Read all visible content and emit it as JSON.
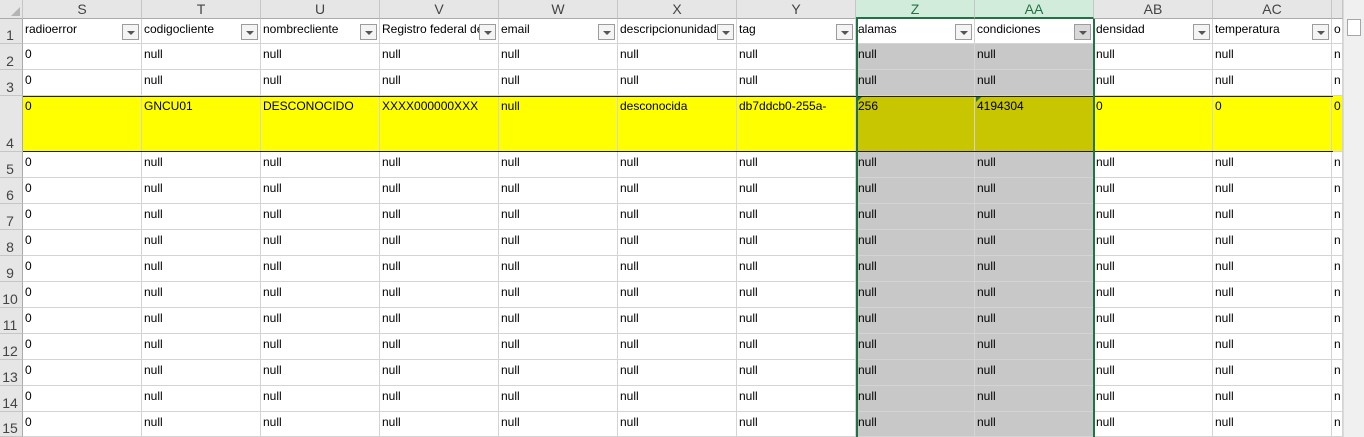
{
  "sheet": {
    "columns": [
      {
        "letter": "S",
        "header": "radioerror"
      },
      {
        "letter": "T",
        "header": "codigocliente"
      },
      {
        "letter": "U",
        "header": "nombrecliente"
      },
      {
        "letter": "V",
        "header": "Registro federal del"
      },
      {
        "letter": "W",
        "header": "email"
      },
      {
        "letter": "X",
        "header": "descripcionunidad"
      },
      {
        "letter": "Y",
        "header": "tag"
      },
      {
        "letter": "Z",
        "header": "alamas"
      },
      {
        "letter": "AA",
        "header": "condiciones"
      },
      {
        "letter": "AB",
        "header": "densidad"
      },
      {
        "letter": "AC",
        "header": "temperatura"
      },
      {
        "letter": "",
        "header": "o"
      }
    ],
    "selected_columns": [
      "Z",
      "AA"
    ],
    "row_numbers": [
      "1",
      "2",
      "3",
      "4",
      "5",
      "6",
      "7",
      "8",
      "9",
      "10",
      "11",
      "12",
      "13",
      "14",
      "15"
    ],
    "rows": [
      [
        "0",
        "null",
        "null",
        "null",
        "null",
        "null",
        "null",
        "null",
        "null",
        "null",
        "null",
        "n"
      ],
      [
        "0",
        "null",
        "null",
        "null",
        "null",
        "null",
        "null",
        "null",
        "null",
        "null",
        "null",
        "n"
      ],
      [
        "0",
        "GNCU01",
        "DESCONOCIDO",
        "XXXX000000XXX",
        "null",
        "desconocida",
        "db7ddcb0-255a-",
        "256",
        "4194304",
        "0",
        "0",
        "0"
      ],
      [
        "0",
        "null",
        "null",
        "null",
        "null",
        "null",
        "null",
        "null",
        "null",
        "null",
        "null",
        "n"
      ],
      [
        "0",
        "null",
        "null",
        "null",
        "null",
        "null",
        "null",
        "null",
        "null",
        "null",
        "null",
        "n"
      ],
      [
        "0",
        "null",
        "null",
        "null",
        "null",
        "null",
        "null",
        "null",
        "null",
        "null",
        "null",
        "n"
      ],
      [
        "0",
        "null",
        "null",
        "null",
        "null",
        "null",
        "null",
        "null",
        "null",
        "null",
        "null",
        "n"
      ],
      [
        "0",
        "null",
        "null",
        "null",
        "null",
        "null",
        "null",
        "null",
        "null",
        "null",
        "null",
        "n"
      ],
      [
        "0",
        "null",
        "null",
        "null",
        "null",
        "null",
        "null",
        "null",
        "null",
        "null",
        "null",
        "n"
      ],
      [
        "0",
        "null",
        "null",
        "null",
        "null",
        "null",
        "null",
        "null",
        "null",
        "null",
        "null",
        "n"
      ],
      [
        "0",
        "null",
        "null",
        "null",
        "null",
        "null",
        "null",
        "null",
        "null",
        "null",
        "null",
        "n"
      ],
      [
        "0",
        "null",
        "null",
        "null",
        "null",
        "null",
        "null",
        "null",
        "null",
        "null",
        "null",
        "n"
      ],
      [
        "0",
        "null",
        "null",
        "null",
        "null",
        "null",
        "null",
        "null",
        "null",
        "null",
        "null",
        "n"
      ],
      [
        "0",
        "null",
        "null",
        "null",
        "null",
        "null",
        "null",
        "null",
        "null",
        "null",
        "null",
        "n"
      ]
    ],
    "highlighted_row": "4",
    "colors": {
      "highlight": "#ffff00",
      "selection": "#c8c8c8",
      "selection_highlight": "#c8c600",
      "accent": "#217346"
    },
    "icons": {
      "filter": "filter-dropdown-icon",
      "active_filter": "filter-dropdown-active-icon"
    }
  }
}
